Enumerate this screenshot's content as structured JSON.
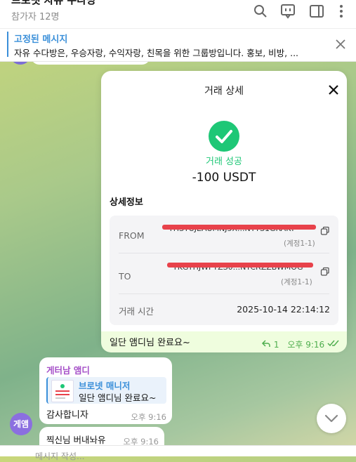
{
  "header": {
    "title": "브로넷 자유 수다방",
    "subtitle": "참가자 12명",
    "icons": [
      "search-icon",
      "comment-icon",
      "sidebar-icon",
      "more-icon"
    ]
  },
  "pinned": {
    "title": "고정된 메시지",
    "text": "자유 수다방은, 우승자랑, 수익자랑, 친목을 위한 그룹방입니다. 홍보, 비방, ..."
  },
  "transaction": {
    "title": "거래 상세",
    "status": "거래 성공",
    "amount": "-100 USDT",
    "details_heading": "상세정보",
    "from_label": "FROM",
    "from_address": "THSTUJEAUMNJ5X...NTTS1GRAKT",
    "from_account": "(계정1-1)",
    "to_label": "TO",
    "to_address": "TKGYHJWFYZS0...NTCRZZBWMOG",
    "to_account": "(계정1-1)",
    "time_label": "거래 시간",
    "time_value": "2025-10-14 22:14:12",
    "accent_color": "#1ec776"
  },
  "outgoing_message": {
    "text": "일단 앰디님 완료요~",
    "replies": "1",
    "time": "오후 9:16"
  },
  "incoming_message": {
    "sender": "게터남 앰디",
    "reply_to_name": "브로넷 매니저",
    "reply_to_text": "일단 앰디님 완료요~",
    "text": "감사합니자",
    "time": "오후 9:16"
  },
  "incoming_message_2": {
    "text": "찍신님 버내놔유",
    "time": "오후 9:16"
  },
  "avatar_label": "게앰",
  "input": {
    "placeholder": "메시지 작성..."
  }
}
